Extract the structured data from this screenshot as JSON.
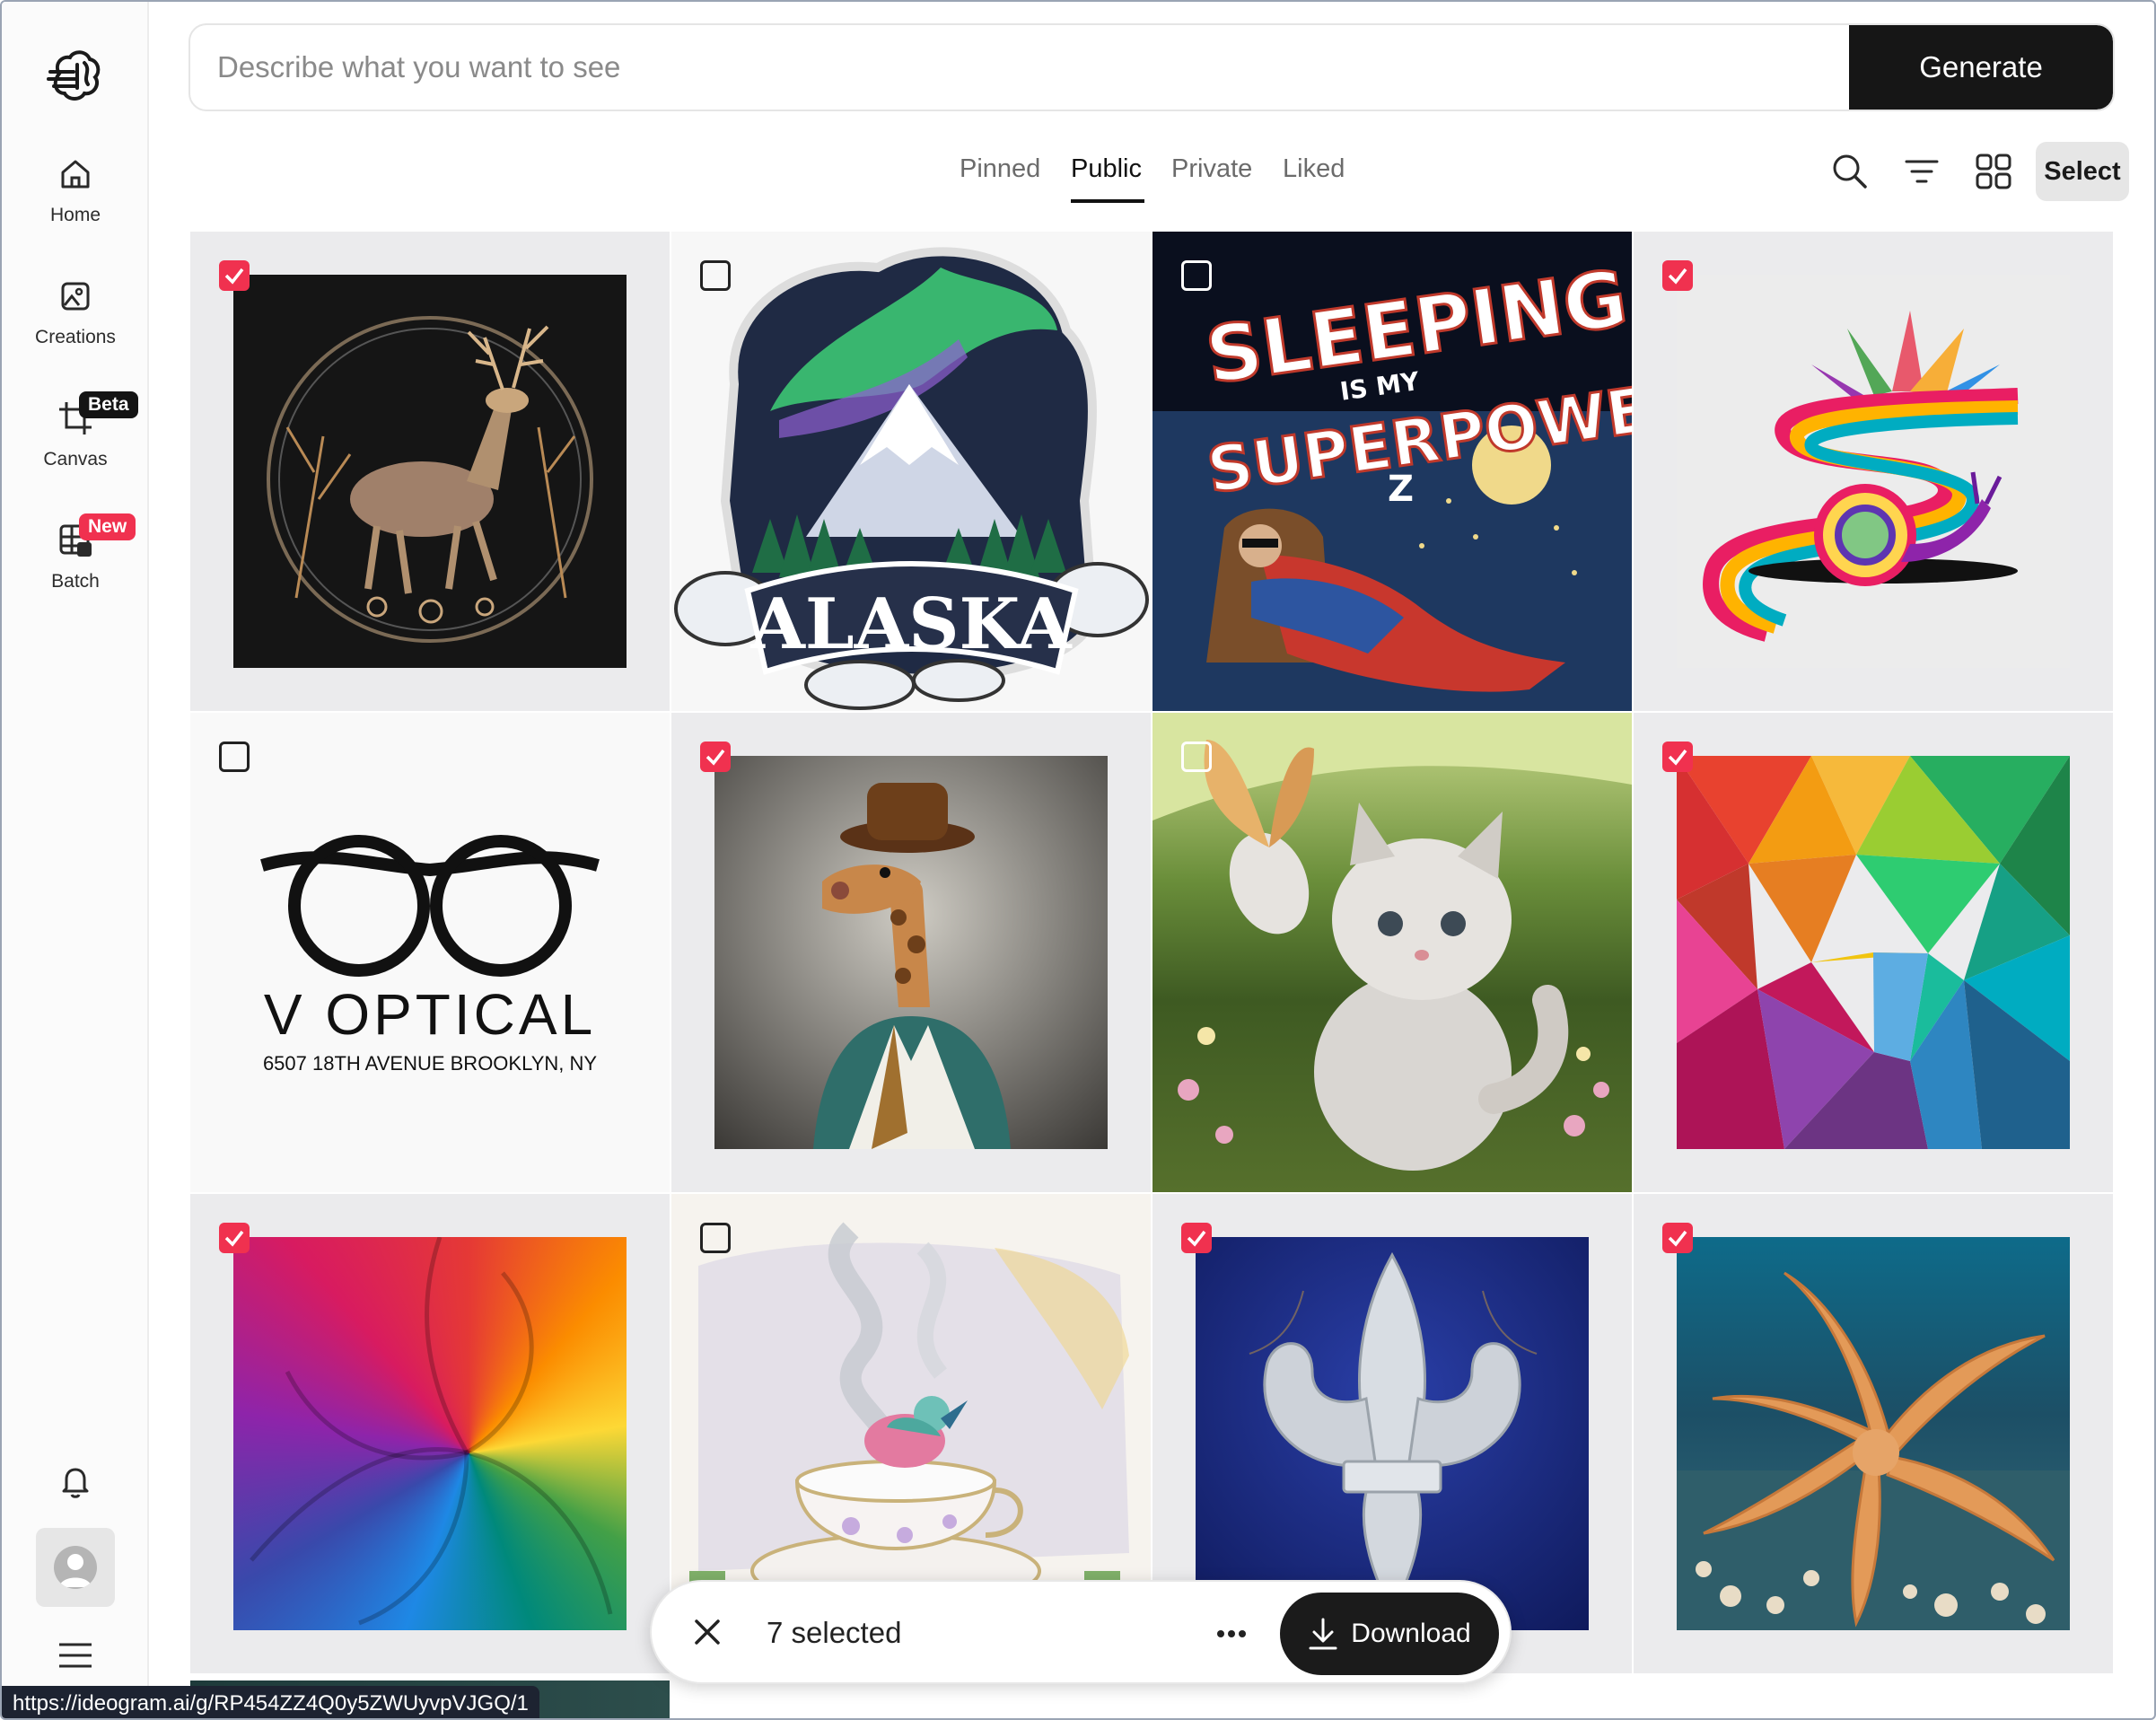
{
  "sidebar": {
    "items": [
      {
        "label": "Home",
        "icon": "home-icon"
      },
      {
        "label": "Creations",
        "icon": "image-icon"
      },
      {
        "label": "Canvas",
        "icon": "canvas-crop-icon",
        "badge": "Beta"
      },
      {
        "label": "Batch",
        "icon": "batch-grid-icon",
        "badge": "New"
      }
    ]
  },
  "prompt": {
    "placeholder": "Describe what you want to see",
    "generate_label": "Generate"
  },
  "tabs": [
    "Pinned",
    "Public",
    "Private",
    "Liked"
  ],
  "active_tab": "Public",
  "toolbar": {
    "select_label": "Select"
  },
  "tiles": [
    {
      "name": "deer-artwork",
      "selected": true
    },
    {
      "name": "alaska-sticker",
      "selected": false,
      "text": "ALASKA"
    },
    {
      "name": "sleeping-superpower",
      "selected": false,
      "line1": "SLEEPING",
      "line2": "IS MY",
      "line3": "SUPERPOWER"
    },
    {
      "name": "rainbow-snail",
      "selected": true
    },
    {
      "name": "v-optical-logo",
      "selected": false,
      "title": "V OPTICAL",
      "address": "6507 18TH AVENUE BROOKLYN, NY"
    },
    {
      "name": "giraffe-portrait",
      "selected": true
    },
    {
      "name": "kitten-butterfly",
      "selected": false
    },
    {
      "name": "low-poly-rainbow",
      "selected": true
    },
    {
      "name": "rainbow-swirl",
      "selected": true
    },
    {
      "name": "teacup-bird",
      "selected": false
    },
    {
      "name": "fleur-de-lis",
      "selected": true
    },
    {
      "name": "starfish-seabed",
      "selected": true
    }
  ],
  "selection_bar": {
    "count_label": "7 selected",
    "download_label": "Download"
  },
  "status_url": "https://ideogram.ai/g/RP454ZZ4Q0y5ZWUyvpVJGQ/1",
  "colors": {
    "accent_red": "#f0314f",
    "dark": "#161616"
  }
}
